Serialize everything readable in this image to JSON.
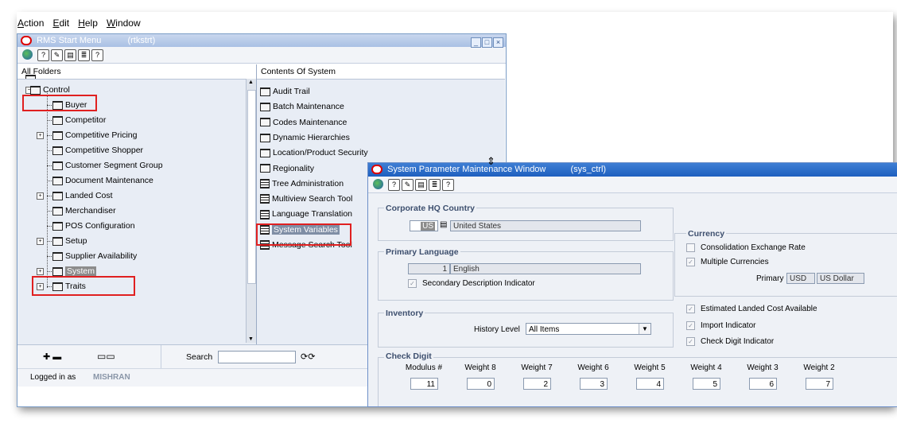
{
  "menu": [
    "Action",
    "Edit",
    "Help",
    "Window"
  ],
  "rms_window": {
    "title": "RMS Start Menu",
    "mode": "(rtkstrt)",
    "toolbar_icons": [
      "globe-icon",
      "help-icon",
      "query-icon",
      "save-icon",
      "print-icon",
      "info-icon"
    ],
    "left_header": "All Folders",
    "right_header": "Contents Of System",
    "tree": [
      {
        "label": "Control",
        "indent": 0,
        "expander": "minus"
      },
      {
        "label": "Buyer",
        "indent": 1
      },
      {
        "label": "Competitor",
        "indent": 1
      },
      {
        "label": "Competitive Pricing",
        "indent": 1,
        "expander": "plus"
      },
      {
        "label": "Competitive Shopper",
        "indent": 1
      },
      {
        "label": "Customer Segment Group",
        "indent": 1
      },
      {
        "label": "Document Maintenance",
        "indent": 1
      },
      {
        "label": "Landed Cost",
        "indent": 1,
        "expander": "plus"
      },
      {
        "label": "Merchandiser",
        "indent": 1
      },
      {
        "label": "POS Configuration",
        "indent": 1
      },
      {
        "label": "Setup",
        "indent": 1,
        "expander": "plus"
      },
      {
        "label": "Supplier Availability",
        "indent": 1
      },
      {
        "label": "System",
        "indent": 1,
        "expander": "plus",
        "selected": true
      },
      {
        "label": "Traits",
        "indent": 1,
        "expander": "plus"
      }
    ],
    "contents": [
      {
        "label": "Audit Trail",
        "icon": "folder"
      },
      {
        "label": "Batch Maintenance",
        "icon": "folder"
      },
      {
        "label": "Codes Maintenance",
        "icon": "folder"
      },
      {
        "label": "Dynamic Hierarchies",
        "icon": "folder"
      },
      {
        "label": "Location/Product Security",
        "icon": "folder"
      },
      {
        "label": "Regionality",
        "icon": "folder"
      },
      {
        "label": "Tree Administration",
        "icon": "table"
      },
      {
        "label": "Multiview Search Tool",
        "icon": "table"
      },
      {
        "label": "Language Translation",
        "icon": "table"
      },
      {
        "label": "System Variables",
        "icon": "table",
        "selected": true
      },
      {
        "label": "Message Search Tool",
        "icon": "table"
      }
    ],
    "search_label": "Search",
    "search_value": "",
    "status_label": "Logged in as",
    "status_user": "MISHRAN"
  },
  "sys_window": {
    "title": "System Parameter Maintenance Window",
    "mode": "(sys_ctrl)",
    "corporate_hq": {
      "title": "Corporate HQ Country",
      "code": "US",
      "name": "United States"
    },
    "primary_language": {
      "title": "Primary Language",
      "code": "1",
      "name": "English",
      "secondary_label": "Secondary Description Indicator"
    },
    "inventory": {
      "title": "Inventory",
      "history_label": "History Level",
      "history_value": "All Items"
    },
    "currency": {
      "title": "Currency",
      "consolidation_label": "Consolidation Exchange Rate",
      "multiple_label": "Multiple Currencies",
      "primary_label": "Primary",
      "primary_code": "USD",
      "primary_name": "US Dollar"
    },
    "flags": {
      "landed_cost": "Estimated Landed Cost Available",
      "import": "Import Indicator",
      "check_digit": "Check Digit Indicator"
    },
    "check_digit": {
      "title": "Check Digit",
      "headers": [
        "Modulus #",
        "Weight 8",
        "Weight 7",
        "Weight 6",
        "Weight 5",
        "Weight 4",
        "Weight 3",
        "Weight 2"
      ],
      "values": [
        "11",
        "0",
        "2",
        "3",
        "4",
        "5",
        "6",
        "7"
      ]
    }
  }
}
